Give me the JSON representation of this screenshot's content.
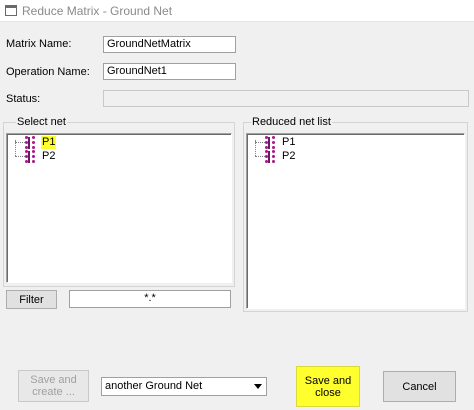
{
  "window": {
    "title": "Reduce Matrix - Ground Net",
    "icon": "window-icon"
  },
  "form": {
    "matrix_name_label": "Matrix Name:",
    "matrix_name_value": "GroundNetMatrix",
    "operation_name_label": "Operation Name:",
    "operation_name_value": "GroundNet1",
    "status_label": "Status:",
    "status_value": ""
  },
  "select_net": {
    "label": "Select net",
    "items": [
      {
        "label": "P1",
        "highlighted": true
      },
      {
        "label": "P2"
      }
    ],
    "icon": "net-icon"
  },
  "reduced_net": {
    "label": "Reduced net list",
    "items": [
      {
        "label": "P1"
      },
      {
        "label": "P2"
      }
    ],
    "icon": "net-icon"
  },
  "filter": {
    "button_label": "Filter",
    "value": "*.*"
  },
  "footer": {
    "save_create_label": "Save and create ...",
    "combo_value": "another Ground Net",
    "save_close_label": "Save and close",
    "cancel_label": "Cancel"
  },
  "colors": {
    "highlight": "#ffff2e",
    "net_icon": "#b0148c"
  }
}
